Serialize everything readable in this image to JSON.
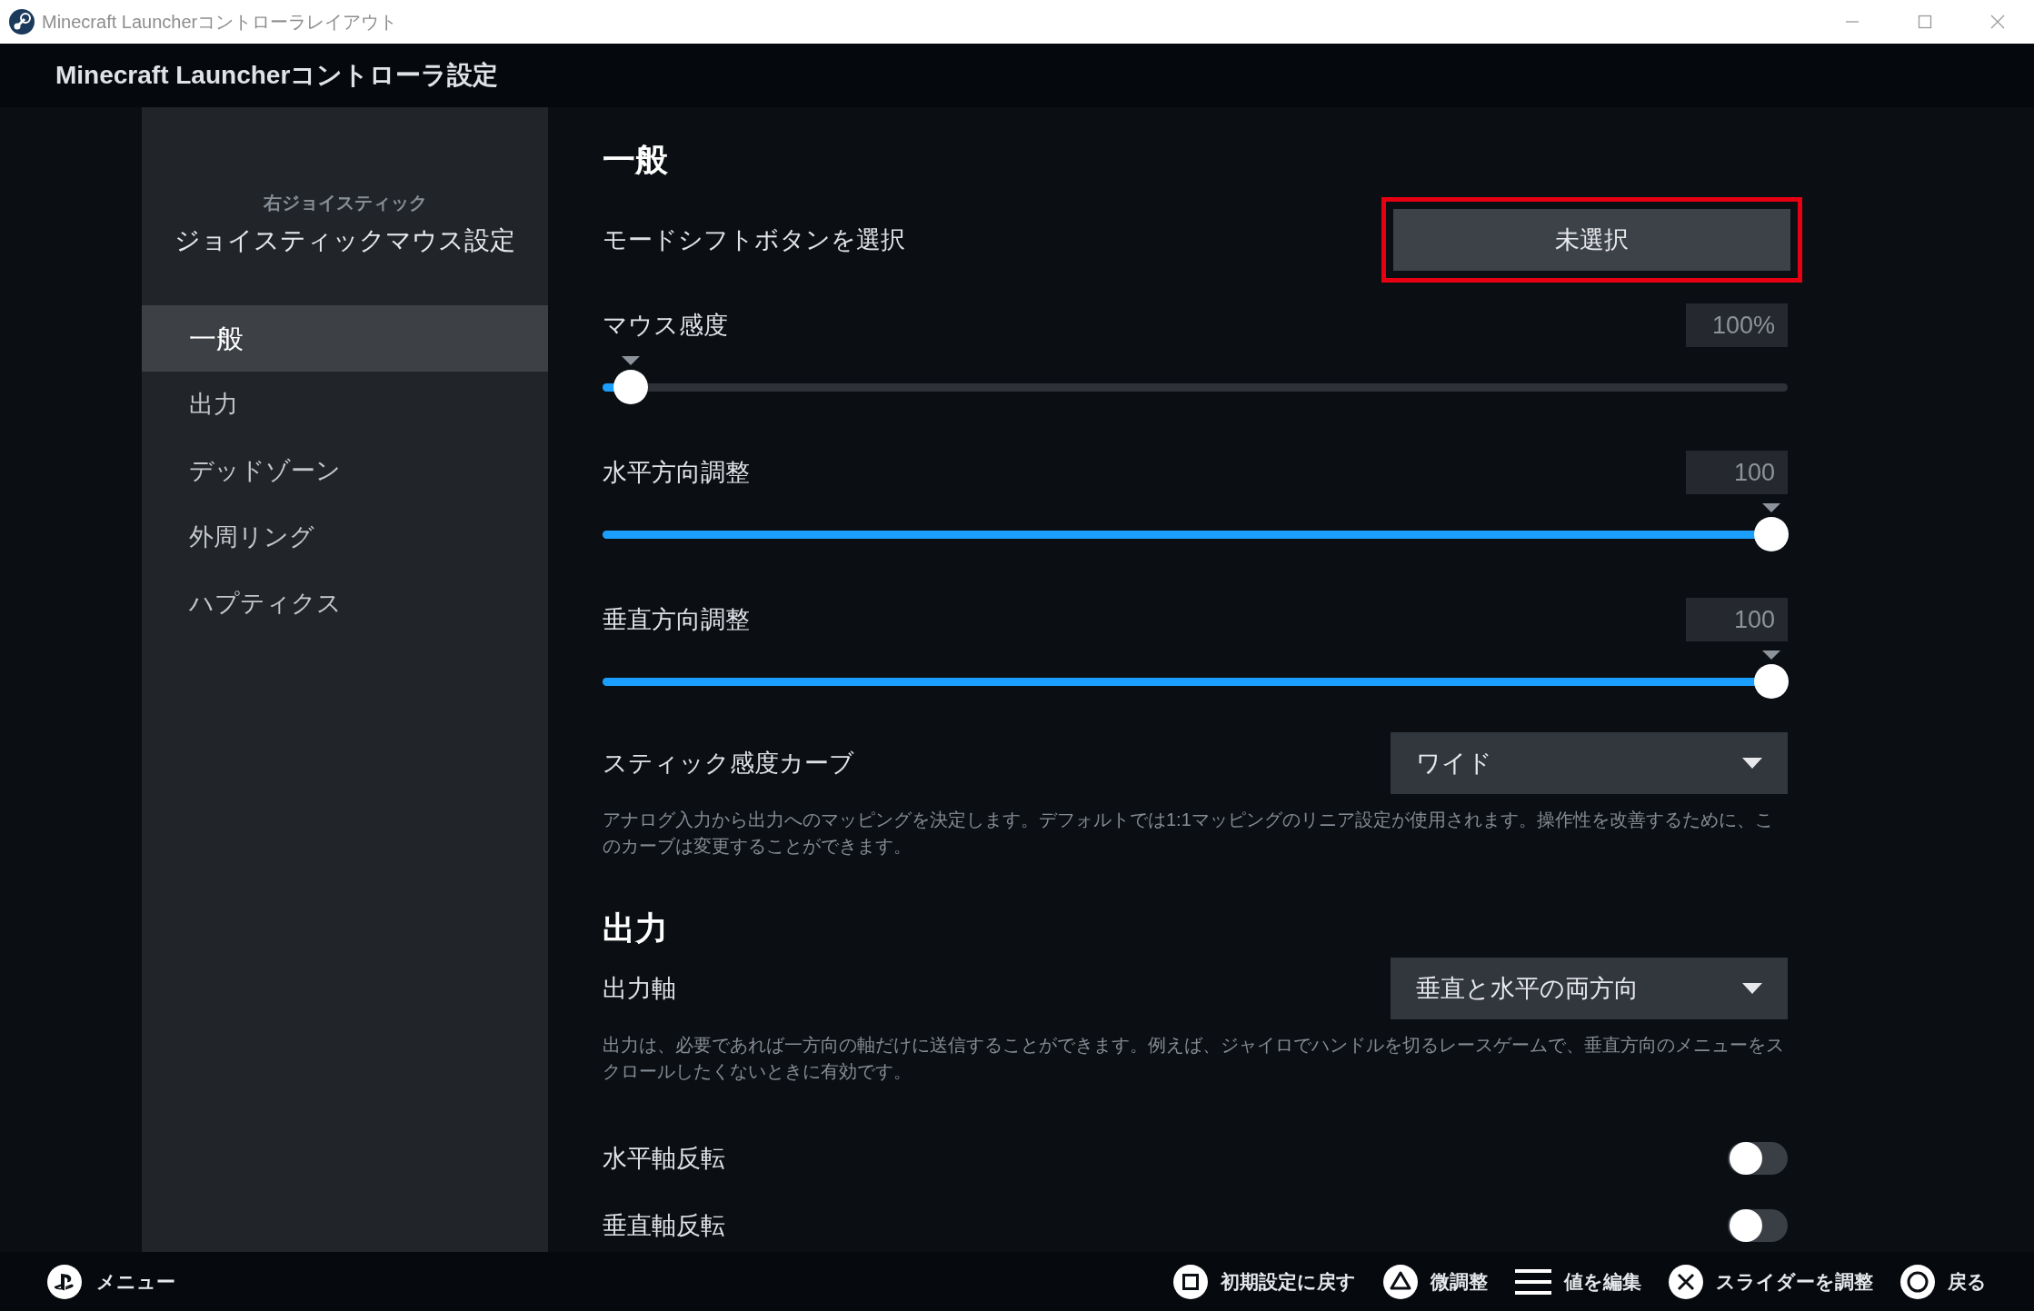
{
  "window": {
    "title": "Minecraft Launcherコントローラレイアウト"
  },
  "header": {
    "title": "Minecraft Launcherコントローラ設定"
  },
  "sidebar": {
    "subtitle": "右ジョイスティック",
    "title": "ジョイスティックマウス設定",
    "items": [
      {
        "label": "一般",
        "selected": true
      },
      {
        "label": "出力",
        "selected": false
      },
      {
        "label": "デッドゾーン",
        "selected": false
      },
      {
        "label": "外周リング",
        "selected": false
      },
      {
        "label": "ハプティクス",
        "selected": false
      }
    ]
  },
  "sections": [
    {
      "heading": "一般",
      "rows": [
        {
          "kind": "button",
          "label": "モードシフトボタンを選択",
          "value": "未選択",
          "highlighted": true
        },
        {
          "kind": "slider",
          "label": "マウス感度",
          "reading": "100%",
          "level": 0.01
        },
        {
          "kind": "slider",
          "label": "水平方向調整",
          "reading": "100",
          "level": 1
        },
        {
          "kind": "slider",
          "label": "垂直方向調整",
          "reading": "100",
          "level": 1
        },
        {
          "kind": "dropdown",
          "label": "スティック感度カーブ",
          "value": "ワイド",
          "description": "アナログ入力から出力へのマッピングを決定します。デフォルトでは1:1マッピングのリニア設定が使用されます。操作性を改善するために、このカーブは変更することができます。"
        }
      ]
    },
    {
      "heading": "出力",
      "rows": [
        {
          "kind": "dropdown",
          "label": "出力軸",
          "value": "垂直と水平の両方向",
          "description": "出力は、必要であれば一方向の軸だけに送信することができます。例えば、ジャイロでハンドルを切るレースゲームで、垂直方向のメニューをスクロールしたくないときに有効です。"
        },
        {
          "kind": "toggle",
          "label": "水平軸反転",
          "on": false
        },
        {
          "kind": "toggle",
          "label": "垂直軸反転",
          "on": false
        }
      ]
    }
  ],
  "footer": {
    "menu": {
      "kind": "ps",
      "label": "メニュー"
    },
    "hints": [
      {
        "kind": "square",
        "label": "初期設定に戻す"
      },
      {
        "kind": "triangle",
        "label": "微調整"
      },
      {
        "kind": "lines",
        "label": "値を編集"
      },
      {
        "kind": "cross",
        "label": "スライダーを調整"
      },
      {
        "kind": "circle",
        "label": "戻る"
      }
    ]
  }
}
